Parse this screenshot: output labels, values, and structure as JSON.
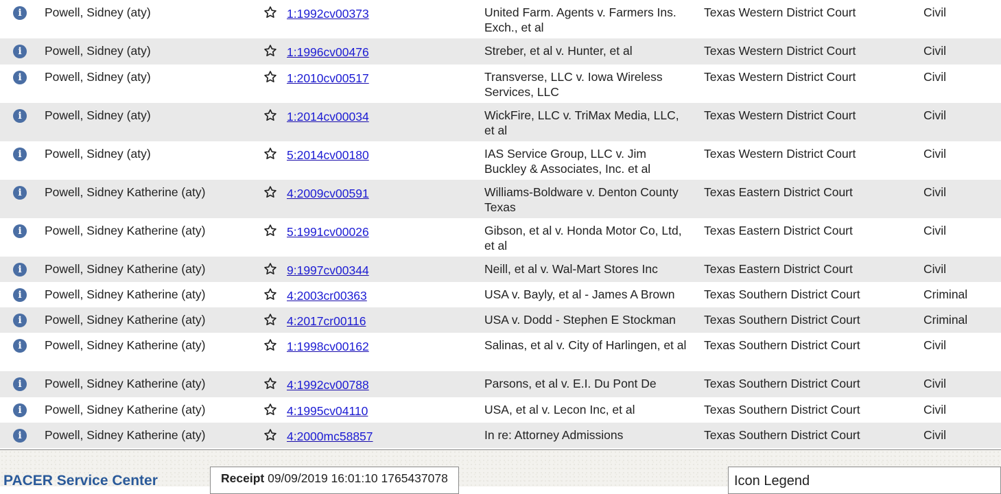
{
  "colors": {
    "link": "#1c1cd4",
    "info_icon": "#4a6ea4",
    "row_alt": "#e9e9e9",
    "brand_title": "#2a5a9a"
  },
  "icons": {
    "info": "info-circle-icon",
    "star": "star-outline-icon"
  },
  "rows": [
    {
      "name": "Powell, Sidney (aty)",
      "case": "1:1992cv00373",
      "title": "United Farm. Agents v. Farmers Ins. Exch., et al",
      "court": "Texas Western District Court",
      "type": "Civil"
    },
    {
      "name": "Powell, Sidney (aty)",
      "case": "1:1996cv00476",
      "title": "Streber, et al v. Hunter, et al",
      "court": "Texas Western District Court",
      "type": "Civil"
    },
    {
      "name": "Powell, Sidney (aty)",
      "case": "1:2010cv00517",
      "title": "Transverse, LLC v. Iowa Wireless Services, LLC",
      "court": "Texas Western District Court",
      "type": "Civil"
    },
    {
      "name": "Powell, Sidney (aty)",
      "case": "1:2014cv00034",
      "title": "WickFire, LLC v. TriMax Media, LLC, et al",
      "court": "Texas Western District Court",
      "type": "Civil"
    },
    {
      "name": "Powell, Sidney (aty)",
      "case": "5:2014cv00180",
      "title": "IAS Service Group, LLC v. Jim Buckley & Associates, Inc. et al",
      "court": "Texas Western District Court",
      "type": "Civil"
    },
    {
      "name": "Powell, Sidney Katherine (aty)",
      "case": "4:2009cv00591",
      "title": "Williams-Boldware v. Denton County Texas",
      "court": "Texas Eastern District Court",
      "type": "Civil"
    },
    {
      "name": "Powell, Sidney Katherine (aty)",
      "case": "5:1991cv00026",
      "title": "Gibson, et al v. Honda Motor Co, Ltd, et al",
      "court": "Texas Eastern District Court",
      "type": "Civil"
    },
    {
      "name": "Powell, Sidney Katherine (aty)",
      "case": "9:1997cv00344",
      "title": "Neill, et al v. Wal-Mart Stores Inc",
      "court": "Texas Eastern District Court",
      "type": "Civil"
    },
    {
      "name": "Powell, Sidney Katherine (aty)",
      "case": "4:2003cr00363",
      "title": "USA v. Bayly, et al - James A Brown",
      "court": "Texas Southern District Court",
      "type": "Criminal"
    },
    {
      "name": "Powell, Sidney Katherine (aty)",
      "case": "4:2017cr00116",
      "title": "USA v. Dodd - Stephen E Stockman",
      "court": "Texas Southern District Court",
      "type": "Criminal"
    },
    {
      "name": "Powell, Sidney Katherine (aty)",
      "case": "1:1998cv00162",
      "title": "Salinas, et al v. City of Harlingen, et al",
      "court": "Texas Southern District Court",
      "type": "Civil"
    },
    {
      "name": "Powell, Sidney Katherine (aty)",
      "case": "4:1992cv00788",
      "title": "Parsons, et al v. E.I. Du Pont De",
      "court": "Texas Southern District Court",
      "type": "Civil"
    },
    {
      "name": "Powell, Sidney Katherine (aty)",
      "case": "4:1995cv04110",
      "title": "USA, et al v. Lecon Inc, et al",
      "court": "Texas Southern District Court",
      "type": "Civil"
    },
    {
      "name": "Powell, Sidney Katherine (aty)",
      "case": "4:2000mc58857",
      "title": "In re: Attorney Admissions",
      "court": "Texas Southern District Court",
      "type": "Civil"
    }
  ],
  "footer": {
    "service_center": "PACER Service Center",
    "receipt_label": "Receipt",
    "receipt_value": "09/09/2019 16:01:10 1765437078",
    "legend_title": "Icon Legend"
  }
}
